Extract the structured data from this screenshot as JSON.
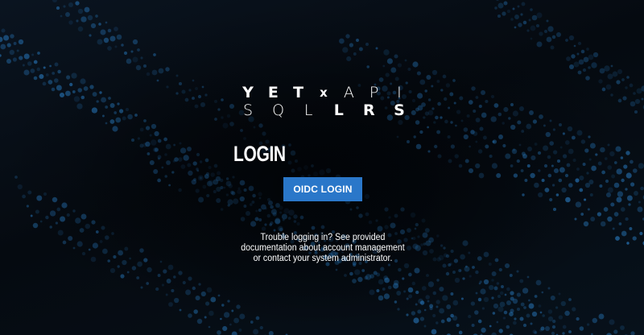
{
  "brand": {
    "line1": [
      "Y",
      "E",
      "T",
      "x",
      "A",
      "P",
      "I"
    ],
    "line2": [
      "S",
      "Q",
      "L",
      "L",
      "R",
      "S"
    ]
  },
  "login": {
    "title": "LOGIN",
    "oidc_button_label": "OIDC LOGIN",
    "help_text": "Trouble logging in? See provided documentation about account management or contact your system administrator."
  },
  "colors": {
    "button": "#2a77c9",
    "background": "#05080d",
    "dots": "#2f8fe0"
  }
}
